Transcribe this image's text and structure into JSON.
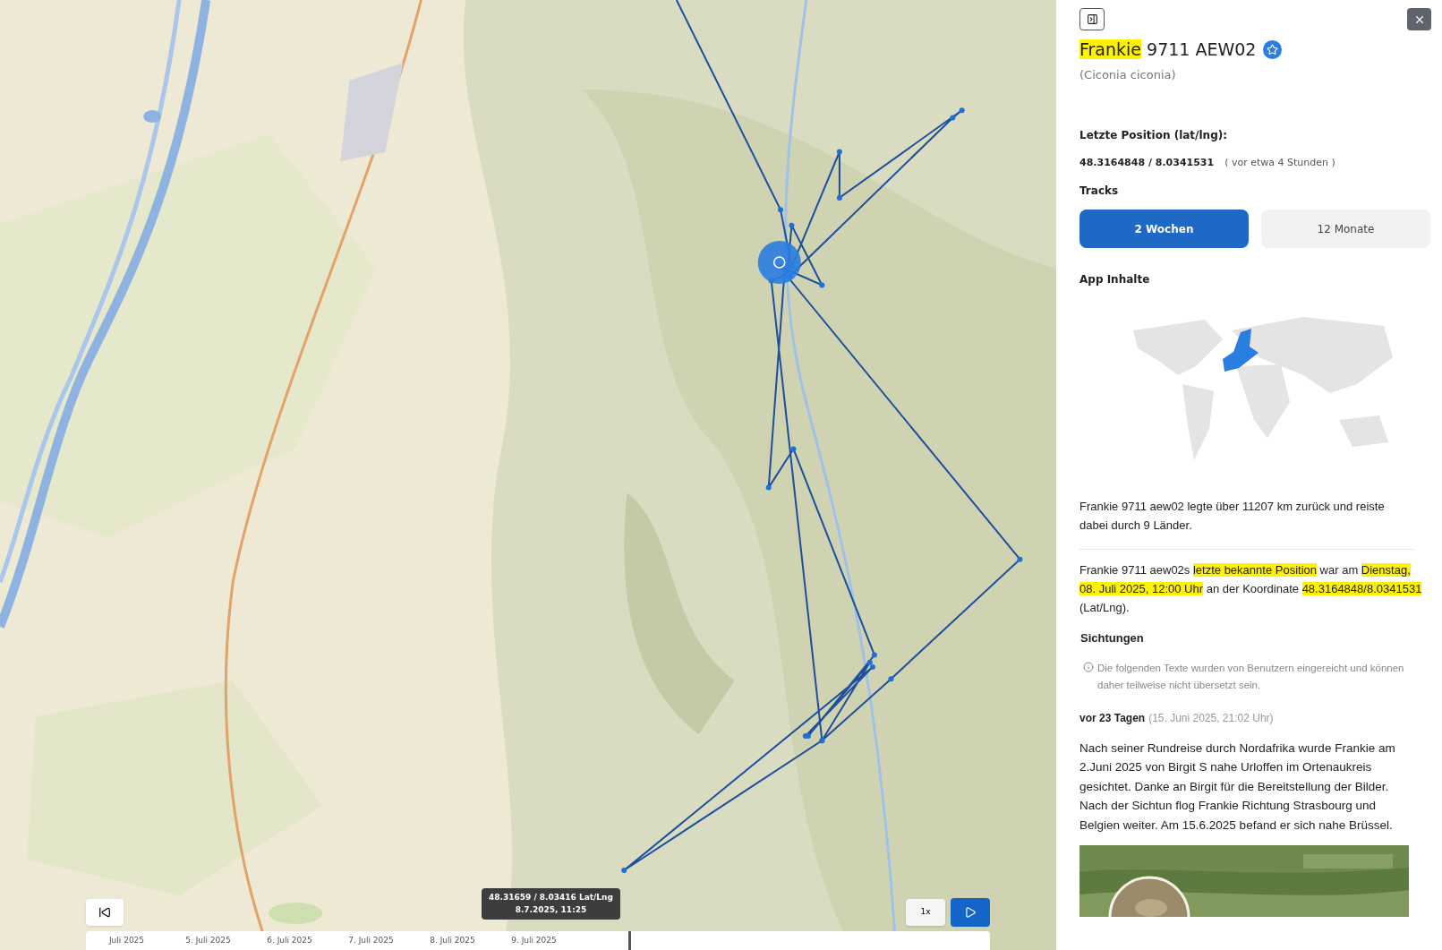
{
  "map": {
    "tooltip": {
      "coords": "48.31659 / 8.03416 Lat/Lng",
      "time": "8.7.2025, 11:25"
    },
    "speed_button": "1x",
    "timeline": {
      "dates": [
        "Juli 2025",
        "5. Juli 2025",
        "6. Juli 2025",
        "7. Juli 2025",
        "8. Juli 2025",
        "9. Juli 2025"
      ]
    }
  },
  "panel": {
    "title": [
      {
        "text": "Frankie",
        "highlighted": true
      },
      {
        "text": " 9711 AEW02",
        "highlighted": false
      }
    ],
    "species": "(Ciconia ciconia)",
    "position_label": "Letzte Position (lat/lng):",
    "position_value": "48.3164848 / 8.0341531",
    "position_age": "( vor etwa 4 Stunden )",
    "tracks_label": "Tracks",
    "track_tabs": [
      {
        "label": "2 Wochen",
        "selected": true
      },
      {
        "label": "12 Monate",
        "selected": false
      }
    ],
    "app_label": "App Inhalte",
    "summary": "Frankie 9711 aew02 legte über 11207 km zurück und reiste dabei durch 9 Länder.",
    "last_position": [
      {
        "text": "Frankie 9711 aew02s ",
        "highlighted": false
      },
      {
        "text": "letzte bekannte Position",
        "highlighted": true
      },
      {
        "text": " war am ",
        "highlighted": false
      },
      {
        "text": "Dienstag, 08. Juli 2025, 12:00 Uhr",
        "highlighted": true
      },
      {
        "text": " an der Koordinate ",
        "highlighted": false
      },
      {
        "text": "48.3164848/8.0341531",
        "highlighted": true
      },
      {
        "text": " (Lat/Lng).",
        "highlighted": false
      }
    ],
    "sightings_label": "Sichtungen",
    "notice": "Die folgenden Texte wurden von Benutzern eingereicht und können daher teilweise nicht übersetzt sein.",
    "sighting": {
      "age": "vor 23 Tagen",
      "date": "(15. Juni 2025, 21:02 Uhr)",
      "text": "Nach seiner Rundreise durch Nordafrika wurde Frankie am 2.Juni 2025 von Birgit S nahe Urloffen im Ortenaukreis gesichtet. Danke an Birgit für die Bereitstellung der Bilder. Nach der Sichtun flog Frankie Richtung Strasbourg und Belgien weiter. Am 15.6.2025 befand er sich nahe Brüssel."
    }
  }
}
